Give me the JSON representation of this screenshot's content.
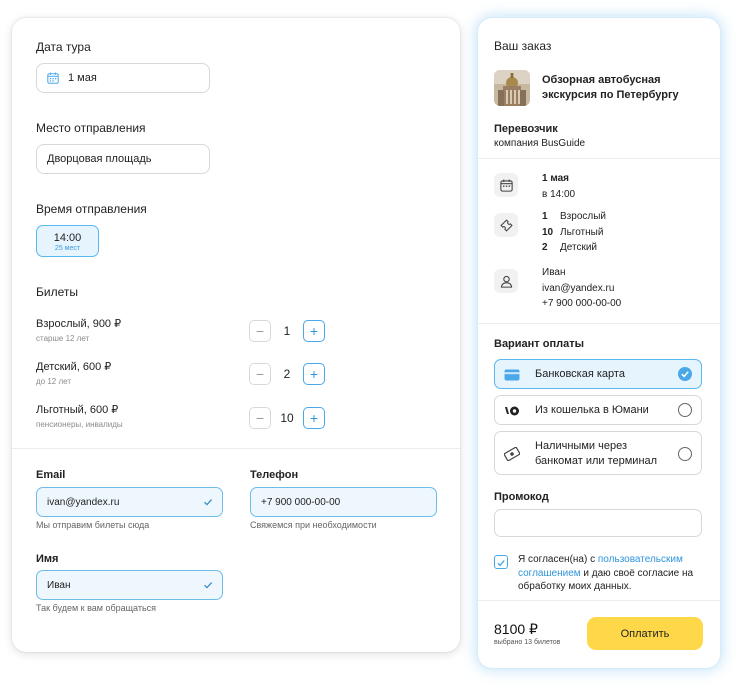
{
  "form": {
    "date_title": "Дата тура",
    "date_value": "1 мая",
    "place_title": "Место отправления",
    "place_value": "Дворцовая площадь",
    "time_title": "Время отправления",
    "time_value": "14:00",
    "time_seats": "25 мест",
    "tickets_title": "Билеты",
    "tickets": [
      {
        "name": "Взрослый, 900 ₽",
        "note": "старше 12 лет",
        "count": "1"
      },
      {
        "name": "Детский, 600 ₽",
        "note": "до 12 лет",
        "count": "2"
      },
      {
        "name": "Льготный, 600 ₽",
        "note": "пенсионеры, инвалиды",
        "count": "10"
      }
    ],
    "minus": "−",
    "plus": "+",
    "email_label": "Email",
    "email_value": "ivan@yandex.ru",
    "email_hint": "Мы отправим билеты сюда",
    "phone_label": "Телефон",
    "phone_value": "+7 900 000-00-00",
    "phone_hint": "Свяжемся при необходимости",
    "name_label": "Имя",
    "name_value": "Иван",
    "name_hint": "Так будем к вам обращаться"
  },
  "order": {
    "title": "Ваш заказ",
    "tour_name": "Обзорная автобусная экскурсия по Петербургу",
    "carrier_title": "Перевозчик",
    "carrier_name": "компания BusGuide",
    "date": "1 мая",
    "time": "в 14:00",
    "tickets": [
      {
        "count": "1",
        "label": "Взрослый"
      },
      {
        "count": "10",
        "label": "Льготный"
      },
      {
        "count": "2",
        "label": "Детский"
      }
    ],
    "contact_name": "Иван",
    "contact_email": "ivan@yandex.ru",
    "contact_phone": "+7 900 000-00-00",
    "payment_title": "Вариант оплаты",
    "payment_options": [
      {
        "label": "Банковская карта",
        "selected": true
      },
      {
        "label": "Из кошелька в Юмани",
        "selected": false
      },
      {
        "label": "Наличными через банкомат или терминал",
        "selected": false
      }
    ],
    "promo_title": "Промокод",
    "agree_prefix": "Я согласен(на) с ",
    "agree_link": "пользовательским соглашением",
    "agree_suffix": " и даю своё согласие на обработку моих данных.",
    "total": "8100 ₽",
    "total_sub": "выбрано 13 билетов",
    "pay_button": "Оплатить"
  },
  "colors": {
    "accent": "#4aa8e8",
    "pay_button": "#ffd84a"
  }
}
